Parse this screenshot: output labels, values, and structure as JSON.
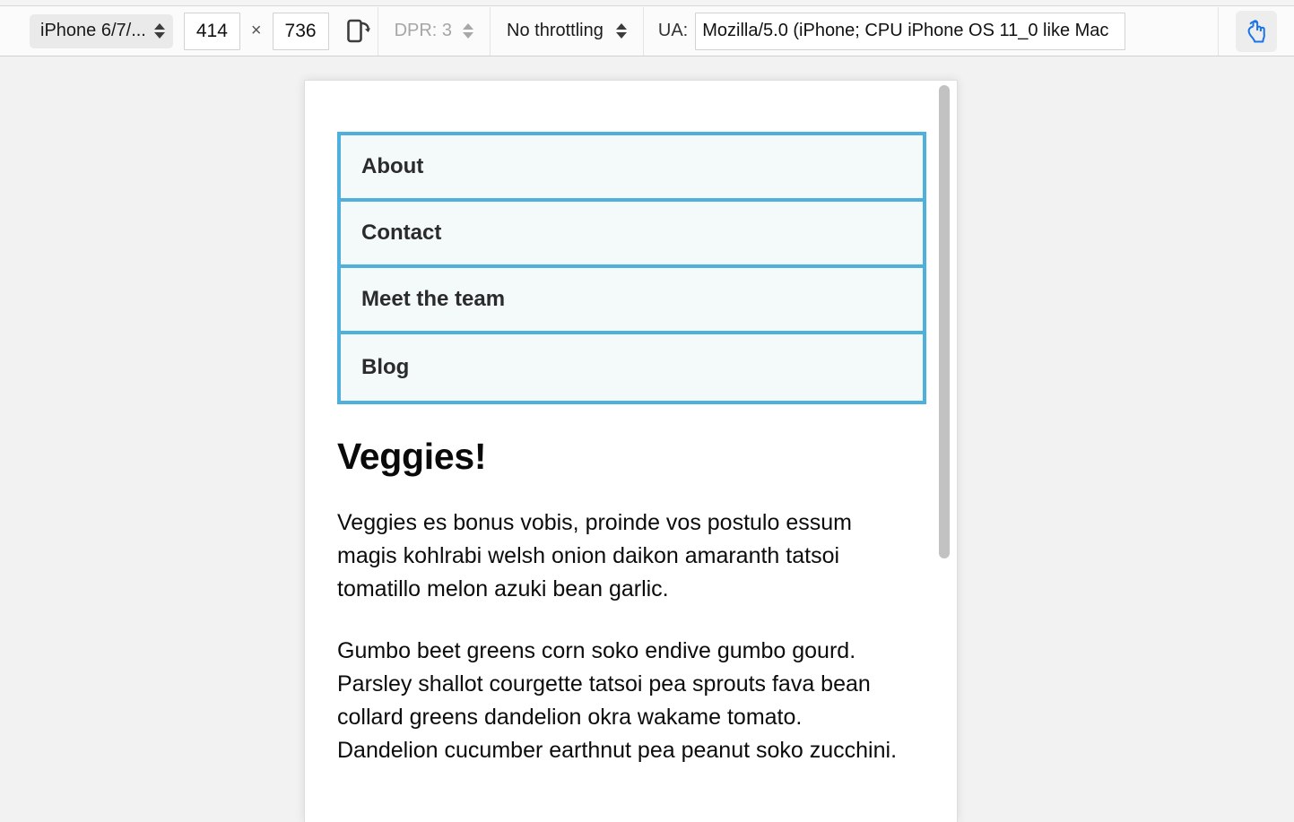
{
  "device_toolbar": {
    "device_select": {
      "value": "iPhone 6/7/...",
      "caret_icon": "spinner-up-down-icon"
    },
    "width_input": {
      "value": "414"
    },
    "multiply_symbol": "×",
    "height_input": {
      "value": "736"
    },
    "rotate_button": {
      "icon": "rotate-device-icon"
    },
    "dpr": {
      "label": "DPR: 3",
      "disabled": true,
      "caret_icon": "spinner-up-down-icon"
    },
    "throttling": {
      "value": "No throttling",
      "caret_icon": "spinner-up-down-icon"
    },
    "user_agent": {
      "label": "UA:",
      "value": "Mozilla/5.0 (iPhone; CPU iPhone OS 11_0 like Mac",
      "placeholder": "Custom user agent"
    },
    "touch_toggle": {
      "icon": "touch-hand-icon",
      "active": true,
      "accent_color": "#1a73e8"
    }
  },
  "viewport": {
    "scrollbar": {
      "name": "page-scrollbar"
    },
    "nav": {
      "items": [
        {
          "label": "About"
        },
        {
          "label": "Contact"
        },
        {
          "label": "Meet the team"
        },
        {
          "label": "Blog"
        }
      ],
      "border_color": "#4fb0dd",
      "background_color": "#f4f9f9"
    },
    "article": {
      "heading": "Veggies!",
      "paragraphs": [
        "Veggies es bonus vobis, proinde vos postulo essum magis kohlrabi welsh onion daikon amaranth tatsoi tomatillo melon azuki bean garlic.",
        "Gumbo beet greens corn soko endive gumbo gourd. Parsley shallot courgette tatsoi pea sprouts fava bean collard greens dandelion okra wakame tomato. Dandelion cucumber earthnut pea peanut soko zucchini."
      ]
    }
  }
}
